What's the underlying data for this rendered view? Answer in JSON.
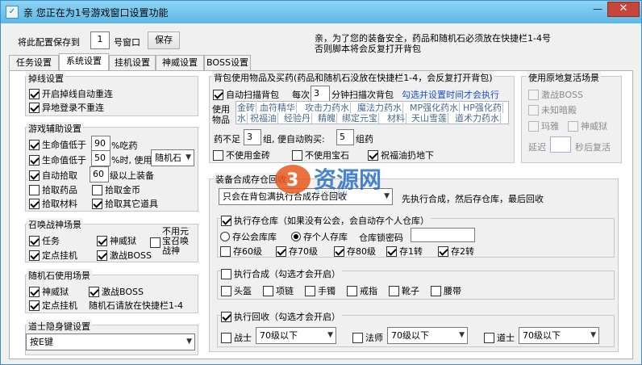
{
  "window": {
    "title": "亲 您正在为1号游戏窗口设置功能",
    "minimize": "—",
    "close": "✕"
  },
  "top": {
    "save_to_label": "将此配置保存到",
    "window_no": "1",
    "window_suffix": "号窗口",
    "save_button": "保存",
    "notice_line1": "亲，为了您的装备安全，药品和随机石必须放在快捷栏1-4号",
    "notice_line2": "否则脚本将会反复打开背包"
  },
  "tabs": [
    "任务设置",
    "系统设置",
    "挂机设置",
    "神威设置",
    "BOSS设置"
  ],
  "disconnect": {
    "title": "掉线设置",
    "items": [
      {
        "label": "开启掉线自动重连",
        "checked": true
      },
      {
        "label": "异地登录不重连",
        "checked": true
      }
    ]
  },
  "assist": {
    "title": "游戏辅助设置",
    "hp_low_label": "生命值低于",
    "hp_low_value": "90",
    "hp_low_suffix": "%吃药",
    "hp_low2_label": "生命值低于",
    "hp_low2_value": "50",
    "hp_low2_suffix": "%时, 使用",
    "hp_low2_item": "随机石",
    "auto_pick_label": "自动拾取",
    "auto_pick_value": "60",
    "auto_pick_suffix": "级以上装备",
    "pick_items": [
      {
        "label": "拾取药品",
        "checked": false
      },
      {
        "label": "拾取金币",
        "checked": false
      },
      {
        "label": "拾取材料",
        "checked": true
      },
      {
        "label": "拾取其它道具",
        "checked": true
      }
    ]
  },
  "summon": {
    "title": "召唤战神场景",
    "items": [
      {
        "label": "任务",
        "checked": true
      },
      {
        "label": "神威狱",
        "checked": true
      },
      {
        "label": "定点挂机",
        "checked": true
      },
      {
        "label": "激战BOSS",
        "checked": true
      }
    ],
    "side_label_1": "不用元",
    "side_label_2": "宝召唤",
    "side_label_3": "战神"
  },
  "random_stone": {
    "title": "随机石使用场景",
    "items": [
      {
        "label": "神威狱",
        "checked": true
      },
      {
        "label": "激战BOSS",
        "checked": true
      },
      {
        "label": "定点挂机",
        "checked": true
      }
    ],
    "note": "随机石请放在快捷栏1-4"
  },
  "taoist": {
    "title": "道士隐身键设置",
    "key": "按E键"
  },
  "bag": {
    "title": "背包使用物品及买药(药品和随机石没放在快捷栏1-4，会反复打开背包)",
    "auto_scan_label": "自动扫描背包",
    "every_label": "每次",
    "every_value": "3",
    "every_suffix": "分钟扫描次背包",
    "hint": "勾选并设置时间才会执行",
    "use_label_1": "使用",
    "use_label_2": "物品",
    "items_row1": [
      "金砖",
      "血符精华",
      "攻击力药水",
      "魔法力药水",
      "MP强化药水",
      "HP强化药"
    ],
    "items_row2": [
      "水",
      "祝福油",
      "经验丹",
      "精魄",
      "绑定元宝",
      "材料",
      "天山雪莲",
      "道术力药水"
    ],
    "low_label": "药不足",
    "low_value": "3",
    "low_mid": "组, 便自动购买:",
    "buy_value": "5",
    "buy_suffix": "组药",
    "options": [
      {
        "label": "不使用金砖",
        "checked": false
      },
      {
        "label": "不使用宝石",
        "checked": false
      },
      {
        "label": "祝福油扔地下",
        "checked": true
      }
    ]
  },
  "revive": {
    "title": "使用原地复活场景",
    "items": [
      "激战BOSS",
      "未知暗殿",
      "玛雅",
      "神威狱"
    ],
    "delay_label": "延迟",
    "delay_value": "",
    "delay_suffix": "秒后复活"
  },
  "recycle": {
    "title": "装备合成存仓回收",
    "mode": "只会在背包满执行合成存仓回收",
    "mode_note": "先执行合成，然后存仓库，最后回收",
    "store_label": "执行存仓库（如果没有公会，会自动存个人仓库）",
    "store_guild": "存公会库库",
    "store_personal": "存个人存库",
    "lock_label": "仓库锁密码",
    "lock_value": "",
    "store_levels": [
      {
        "label": "存60级",
        "checked": false
      },
      {
        "label": "存70级",
        "checked": true
      },
      {
        "label": "存80级",
        "checked": true
      },
      {
        "label": "存1转",
        "checked": true
      },
      {
        "label": "存2转",
        "checked": true
      }
    ],
    "compose_label": "执行合成（勾选才会开启）",
    "compose_items": [
      "头盔",
      "项链",
      "手镯",
      "戒指",
      "靴子",
      "腰带"
    ],
    "recover_label": "执行回收（勾选才会开启）",
    "recover_classes": [
      {
        "label": "战士",
        "value": "70级以下"
      },
      {
        "label": "法师",
        "value": "70级以下"
      },
      {
        "label": "道士",
        "value": "70级以下"
      }
    ]
  },
  "watermark": {
    "text": "资源网",
    "subtext": "ZIYUAN"
  }
}
